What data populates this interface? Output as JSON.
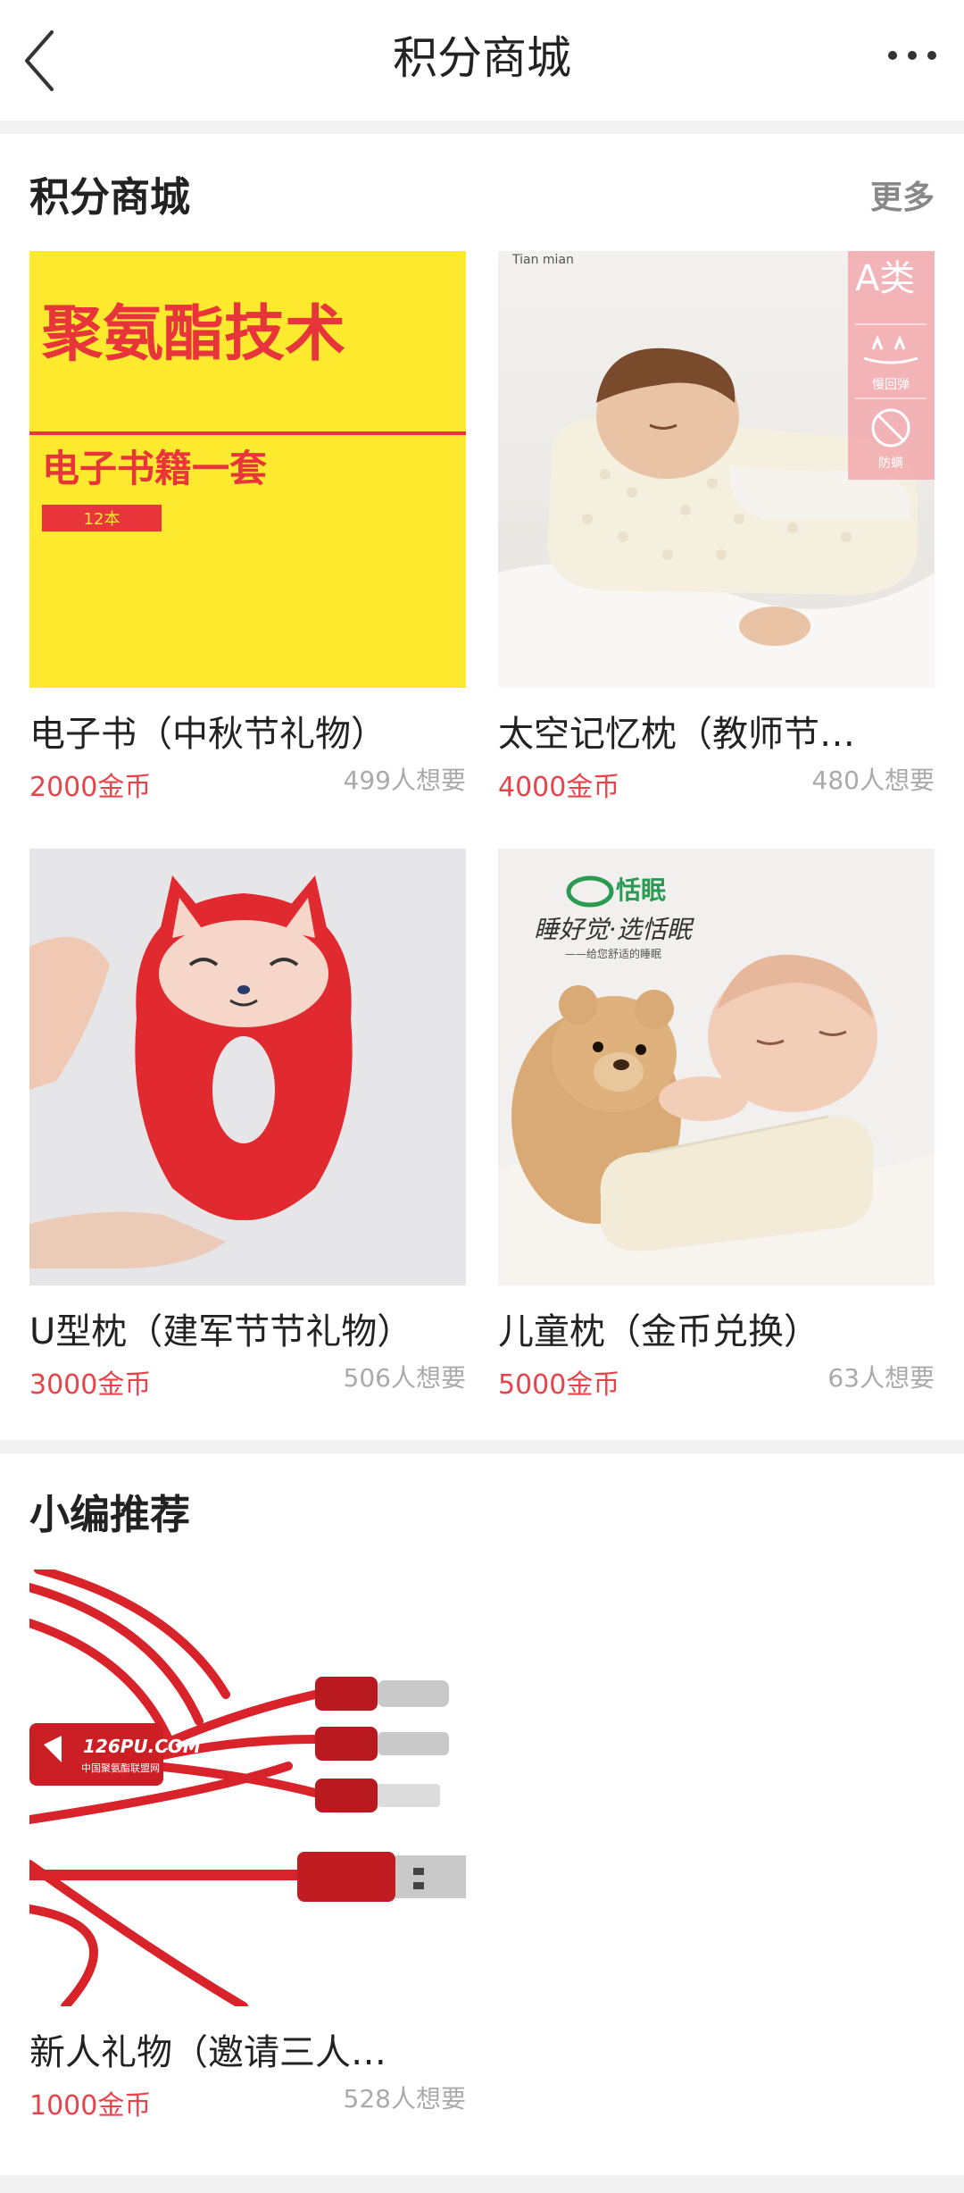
{
  "header": {
    "title": "积分商城",
    "back_icon": "chevron-left-icon",
    "more_icon": "ellipsis-icon"
  },
  "mall": {
    "title": "积分商城",
    "more": "更多",
    "items": [
      {
        "name": "电子书（中秋节礼物）",
        "price": "2000金币",
        "wants": "499人想要",
        "image": {
          "headline": "聚氨酯技术",
          "subline": "电子书籍一套",
          "tag": "12本"
        }
      },
      {
        "name": "太空记忆枕（教师节…",
        "price": "4000金币",
        "wants": "480人想要",
        "image": {
          "brand": "Tian mian",
          "badge_grade": "A类",
          "badge_1": "慢回弹",
          "badge_2": "防螨"
        }
      },
      {
        "name": "U型枕（建军节节礼物）",
        "price": "3000金币",
        "wants": "506人想要"
      },
      {
        "name": "儿童枕（金币兑换）",
        "price": "5000金币",
        "wants": "63人想要",
        "image": {
          "brand": "恬眠",
          "slogan": "睡好觉·选恬眠",
          "subslogan": "——给您舒适的睡眠"
        }
      }
    ]
  },
  "recommend": {
    "title": "小编推荐",
    "items": [
      {
        "name": "新人礼物（邀请三人…",
        "price": "1000金币",
        "wants": "528人想要",
        "image": {
          "logo": "126PU.COM",
          "logo_sub": "中国聚氨酯联盟网"
        }
      }
    ]
  },
  "colors": {
    "price": "#e8434a",
    "ebook_bg": "#fdea2e",
    "accent_red": "#e8343b"
  }
}
